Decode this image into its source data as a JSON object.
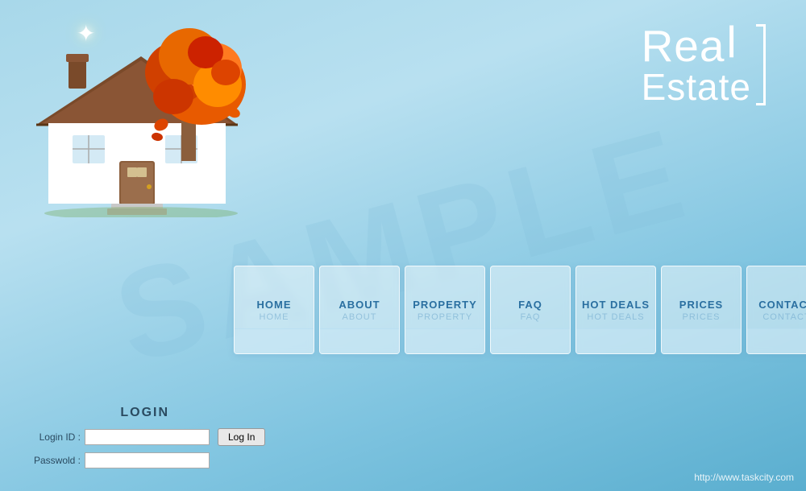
{
  "watermark": "SAMPLE",
  "logo": {
    "line1": "Rea",
    "line2": "Estate"
  },
  "nav_buttons": [
    {
      "id": "home",
      "label": "HOME"
    },
    {
      "id": "about",
      "label": "ABOUT"
    },
    {
      "id": "property",
      "label": "PROPERTY"
    },
    {
      "id": "faq",
      "label": "FAQ"
    },
    {
      "id": "hot-deals",
      "label": "HOT  DEALS"
    },
    {
      "id": "prices",
      "label": "PRICES"
    },
    {
      "id": "contact",
      "label": "CONTACT"
    }
  ],
  "login": {
    "title": "LOGIN",
    "id_label": "Login ID :",
    "password_label": "Passwold :",
    "id_value": "",
    "password_value": "",
    "button_label": "Log In"
  },
  "website": "http://www.taskcity.com"
}
